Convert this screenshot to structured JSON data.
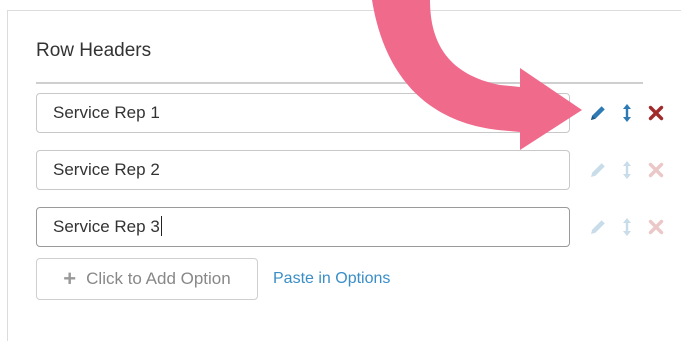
{
  "section": {
    "heading": "Row Headers"
  },
  "rows": [
    {
      "value": "Service Rep 1",
      "active": true
    },
    {
      "value": "Service Rep 2",
      "active": false
    },
    {
      "value": "Service Rep 3",
      "active": false
    }
  ],
  "row_actions": {
    "edit_icon": "pencil-icon",
    "reorder_icon": "updown-arrow-icon",
    "delete_icon": "close-icon"
  },
  "footer": {
    "add_option_label": "Click to Add Option",
    "paste_label": "Paste in Options"
  },
  "colors": {
    "edit_active": "#2e7ab5",
    "delete_active": "#a12a2a",
    "edit_inactive": "#c9dcea",
    "delete_inactive": "#ecc7c7",
    "annotation_arrow": "#f06a8c",
    "link": "#3a8ec6"
  }
}
